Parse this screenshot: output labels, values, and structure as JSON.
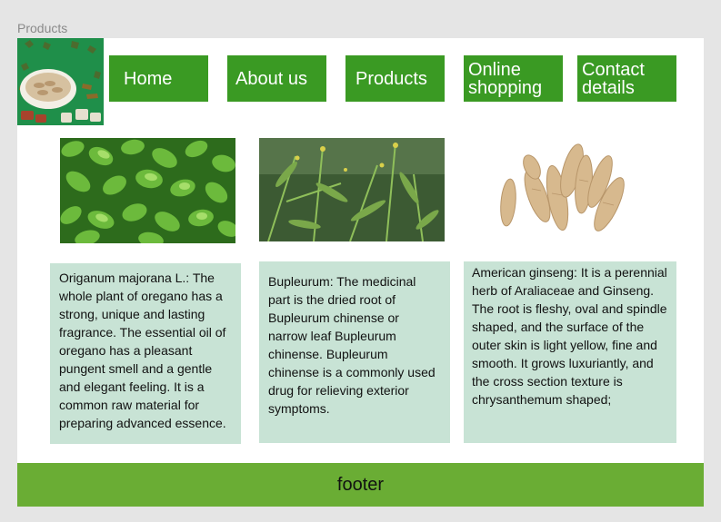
{
  "frame": {
    "label": "Products"
  },
  "nav": [
    {
      "label": "Home"
    },
    {
      "label": "About us"
    },
    {
      "label": "Products"
    },
    {
      "label": "Online\nshopping"
    },
    {
      "label": "Contact\ndetails"
    }
  ],
  "products": [
    {
      "description": "Origanum majorana L.: The whole plant of oregano has a strong, unique and lasting fragrance. The essential oil of oregano has a pleasant pungent smell and a gentle and elegant feeling. It is a common raw material for preparing advanced essence."
    },
    {
      "description": "Bupleurum: The medicinal part is the dried root of Bupleurum chinense or narrow leaf Bupleurum chinense. Bupleurum chinense is a commonly used drug for relieving exterior symptoms."
    },
    {
      "description": "American ginseng: It is a perennial herb of Araliaceae and Ginseng. The root is fleshy, oval and spindle shaped, and the surface of the outer skin is light yellow, fine and smooth. It grows luxuriantly, and the cross section texture is chrysanthemum shaped;"
    }
  ],
  "footer": {
    "label": "footer"
  },
  "colors": {
    "nav_green": "#3a9a23",
    "card_mint": "#c8e3d5",
    "footer_green": "#6aad34"
  }
}
